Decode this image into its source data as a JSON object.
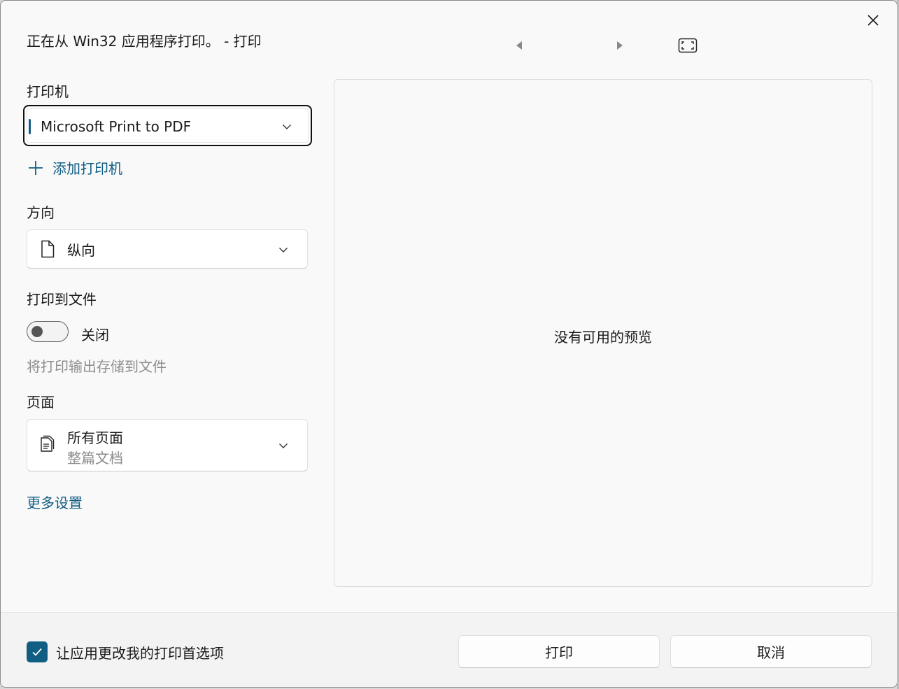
{
  "window": {
    "title": "正在从 Win32 应用程序打印。 - 打印"
  },
  "printer": {
    "label": "打印机",
    "selected": "Microsoft Print to PDF",
    "add_label": "添加打印机"
  },
  "orientation": {
    "label": "方向",
    "selected": "纵向"
  },
  "print_to_file": {
    "label": "打印到文件",
    "state_label": "关闭",
    "description": "将打印输出存储到文件"
  },
  "pages": {
    "label": "页面",
    "selected": "所有页面",
    "selected_sub": "整篇文档"
  },
  "more_settings": "更多设置",
  "preview": {
    "message": "没有可用的预览"
  },
  "footer": {
    "checkbox_label": "让应用更改我的打印首选项",
    "checkbox_checked": true,
    "print_button": "打印",
    "cancel_button": "取消"
  },
  "colors": {
    "accent": "#115e85",
    "background": "#f9f9f9"
  }
}
